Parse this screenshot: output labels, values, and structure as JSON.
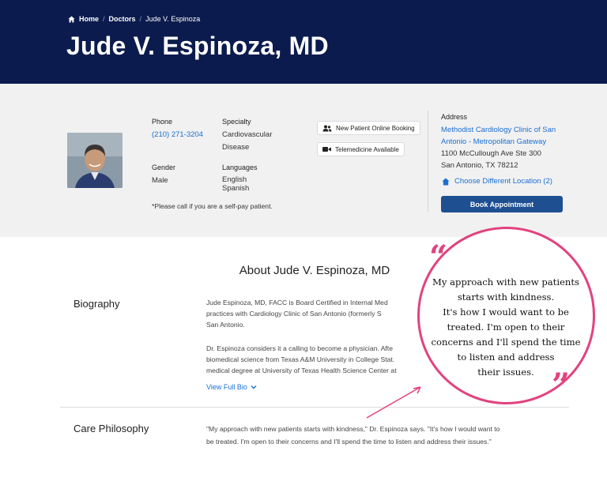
{
  "breadcrumb": {
    "home": "Home",
    "doctors": "Doctors",
    "current": "Jude V. Espinoza"
  },
  "page_title": "Jude V. Espinoza, MD",
  "profile": {
    "phone_label": "Phone",
    "phone": "(210) 271-3204",
    "specialty_label": "Specialty",
    "specialty_line1": "Cardiovascular",
    "specialty_line2": "Disease",
    "gender_label": "Gender",
    "gender": "Male",
    "languages_label": "Languages",
    "language_1": "English",
    "language_2": "Spanish",
    "self_pay_note": "*Please call if you are a self-pay patient."
  },
  "chips": {
    "online_booking": "New Patient Online Booking",
    "telemedicine": "Telemedicine Available"
  },
  "address": {
    "label": "Address",
    "clinic_line1": "Methodist Cardiology Clinic of San",
    "clinic_line2": "Antonio - Metropolitan Gateway",
    "street": "1100 McCullough Ave Ste 300",
    "city": "San Antonio, TX 78212",
    "choose_location": "Choose Different Location (2)",
    "book_button": "Book Appointment"
  },
  "about": {
    "title": "About Jude V. Espinoza, MD",
    "biography_heading": "Biography",
    "bio_lines": [
      "Jude Espinoza, MD, FACC is Board Certified in Internal Med",
      "practices with Cardiology Clinic of San Antonio (formerly S",
      "San Antonio.",
      "Dr. Espinoza considers it a calling to become a physician. Afte",
      "biomedical science from Texas A&M University in College Stat.",
      "medical degree at University of Texas Health Science Center at"
    ],
    "view_full_bio": "View Full Bio",
    "care_heading": "Care Philosophy",
    "care_line1": "\"My approach with new patients starts with kindness,\" Dr. Espinoza says. \"It's how I would want to",
    "care_line2": "be treated. I'm open to their concerns and I'll spend the time to listen and address their issues.\""
  },
  "callout": {
    "lines": [
      "My approach with new patients",
      "starts with kindness.",
      "It's how I would want to be",
      "treated. I'm open to their",
      "concerns and I'll spend the time",
      "to listen and address",
      "their issues."
    ],
    "accent_color": "#e2427f"
  },
  "colors": {
    "header_bg": "#0b1b4d",
    "band_bg": "#f1f1f2",
    "link": "#1a6fd0",
    "button": "#1d4f91"
  }
}
